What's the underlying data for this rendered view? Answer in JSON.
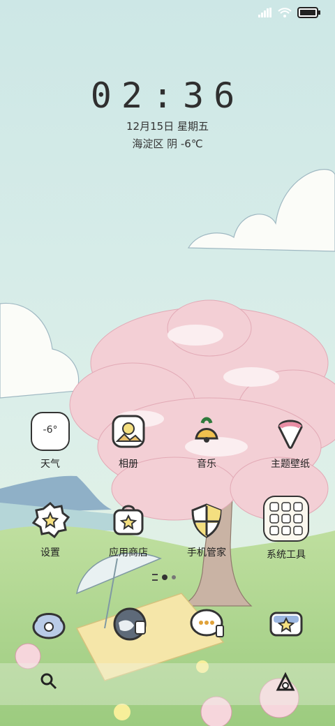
{
  "status_bar": {
    "signal_icon": "signal-icon",
    "wifi_icon": "wifi-icon",
    "battery_icon": "battery-icon"
  },
  "lock": {
    "time": "02:36",
    "date": "12月15日 星期五",
    "weather": "海淀区 阴 -6℃"
  },
  "weather_widget": {
    "temp": "-6°"
  },
  "apps_row1": [
    {
      "label": "天气",
      "icon": "weather-icon"
    },
    {
      "label": "相册",
      "icon": "gallery-icon"
    },
    {
      "label": "音乐",
      "icon": "music-icon"
    },
    {
      "label": "主题壁纸",
      "icon": "theme-icon"
    }
  ],
  "apps_row2": [
    {
      "label": "设置",
      "icon": "settings-gear-icon"
    },
    {
      "label": "应用商店",
      "icon": "app-store-icon"
    },
    {
      "label": "手机管家",
      "icon": "phone-manager-shield-icon"
    },
    {
      "label": "系统工具",
      "icon": "system-tools-folder-icon"
    }
  ],
  "dock": [
    "phone-icon",
    "browser-icon",
    "messages-icon",
    "camera-icon"
  ],
  "bottom": {
    "search_icon": "search-icon",
    "assistant_icon": "assistant-icon"
  },
  "pager": {
    "pages": 3,
    "active": 2
  },
  "colors": {
    "sky": "#cfe6e4",
    "blossom": "#f1c9d1",
    "grass": "#a9cf8a",
    "trunk": "#b49a8b"
  }
}
